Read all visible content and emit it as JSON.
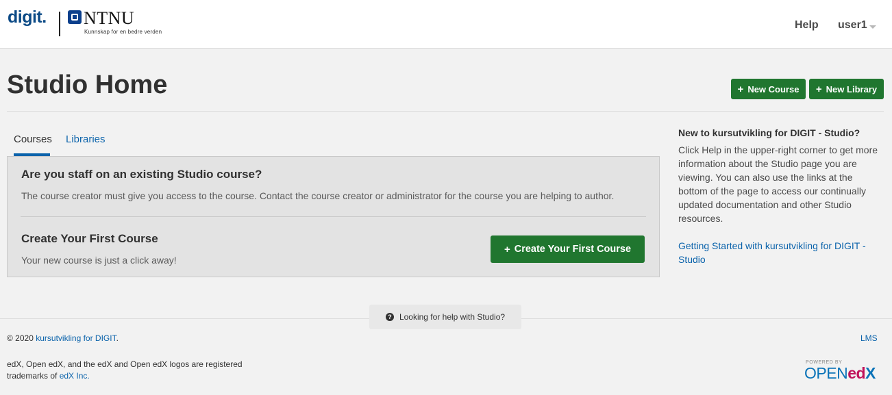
{
  "header": {
    "logo_text": "digit.",
    "ntnu_name": "NTNU",
    "ntnu_tagline": "Kunnskap for en bedre verden",
    "nav": {
      "help": "Help",
      "user": "user1"
    }
  },
  "page": {
    "title": "Studio Home",
    "actions": {
      "new_course": "New Course",
      "new_library": "New Library"
    }
  },
  "tabs": [
    {
      "label": "Courses",
      "active": true
    },
    {
      "label": "Libraries",
      "active": false
    }
  ],
  "panel": {
    "staff_heading": "Are you staff on an existing Studio course?",
    "staff_text": "The course creator must give you access to the course. Contact the course creator or administrator for the course you are helping to author.",
    "create_heading": "Create Your First Course",
    "create_text": "Your new course is just a click away!",
    "create_button": "Create Your First Course"
  },
  "sidebar": {
    "title": "New to kursutvikling for DIGIT - Studio?",
    "text": "Click Help in the upper-right corner to get more information about the Studio page you are viewing. You can also use the links at the bottom of the page to access our continually updated documentation and other Studio resources.",
    "link": "Getting Started with kursutvikling for DIGIT - Studio"
  },
  "help_bar": {
    "label": "Looking for help with Studio?"
  },
  "footer": {
    "copyright_prefix": "© 2020 ",
    "copyright_link": "kursutvikling for DIGIT",
    "copyright_suffix": ".",
    "lms": "LMS",
    "trademark_text": "edX, Open edX, and the edX and Open edX logos are registered trademarks of ",
    "trademark_link": "edX Inc.",
    "powered_by": "POWERED BY",
    "openedx_open": "OPEN",
    "openedx_ed": "ed",
    "openedx_x": "X"
  },
  "colors": {
    "accent_green": "#20762f",
    "link_blue": "#0b63ab",
    "brand_blue": "#0b4a86"
  }
}
